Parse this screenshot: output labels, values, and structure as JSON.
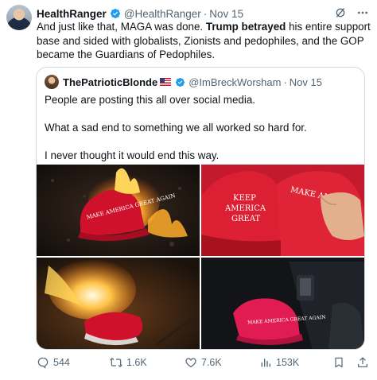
{
  "tweet": {
    "display_name": "HealthRanger",
    "handle": "@HealthRanger",
    "separator": "·",
    "date": "Nov 15",
    "text_part1": "And just like that, MAGA was done. ",
    "text_bold": "Trump betrayed",
    "text_part2": " his entire support base and sided with globalists, Zionists and pedophiles, and the GOP became the Guardians of Pedophiles."
  },
  "quote": {
    "display_name": "ThePatrioticBlonde",
    "handle": "@ImBreckWorsham",
    "separator": "·",
    "date": "Nov 15",
    "paragraphs": [
      "People are posting this all over social media.",
      "What a sad end to something we all worked so hard for.",
      "I never thought it would end this way."
    ],
    "media": {
      "hat1_text": "MAKE AMERICA GREAT AGAIN",
      "hat2_line1": "KEEP",
      "hat2_line2": "AMERICA",
      "hat2_line3": "GREAT",
      "hat3_text": "MAKE AM",
      "hat4_text": "MAKE AMERICA GREAT AGAIN"
    }
  },
  "actions": {
    "replies": "544",
    "reposts": "1.6K",
    "likes": "7.6K",
    "views": "153K"
  },
  "icons": {
    "verified": "verified-badge-icon",
    "grok": "grok-icon",
    "more": "more-icon",
    "reply": "reply-icon",
    "repost": "repost-icon",
    "like": "heart-icon",
    "views": "views-icon",
    "bookmark": "bookmark-icon",
    "share": "share-icon"
  },
  "colors": {
    "verified_blue": "#1d9bf0",
    "text": "#0f1419",
    "secondary": "#536471",
    "border": "#cfd9de",
    "maga_red": "#d0112b"
  }
}
